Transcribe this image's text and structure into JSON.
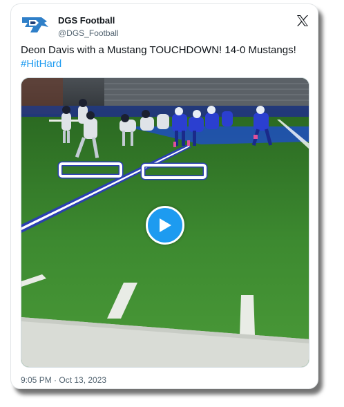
{
  "account": {
    "name": "DGS Football",
    "handle": "@DGS_Football",
    "avatar_icon": "mustang-logo-icon"
  },
  "tweet": {
    "text": "Deon Davis with a Mustang TOUCHDOWN! 14-0 Mustangs! ",
    "hashtag": "#HitHard",
    "timestamp": "9:05 PM · Oct 13, 2023"
  },
  "media": {
    "type": "video",
    "play_icon": "play-icon"
  },
  "colors": {
    "link": "#1d9bf0",
    "text": "#0f1419",
    "muted": "#536471",
    "field": "#2f6b28",
    "team_blue": "#1f4fc0"
  }
}
